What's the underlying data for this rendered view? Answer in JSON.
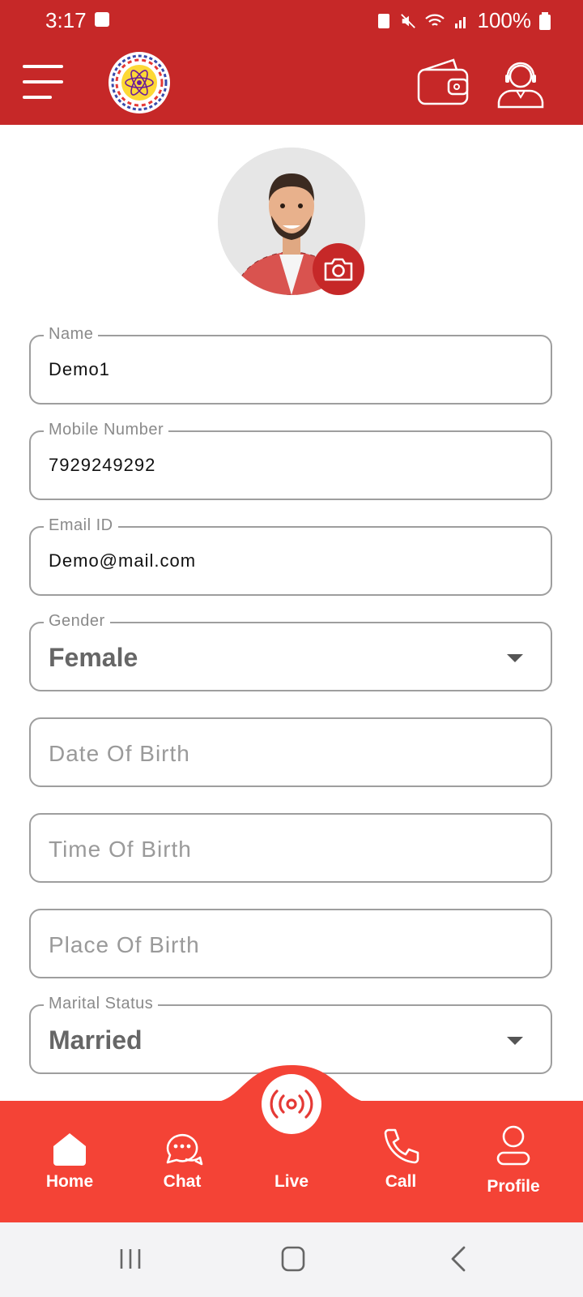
{
  "status_bar": {
    "time": "3:17",
    "battery": "100%"
  },
  "profile": {
    "avatar_alt": "profile photo"
  },
  "form": {
    "name": {
      "label": "Name",
      "value": "Demo1"
    },
    "mobile": {
      "label": "Mobile Number",
      "value": "7929249292"
    },
    "email": {
      "label": "Email ID",
      "value": "Demo@mail.com"
    },
    "gender": {
      "label": "Gender",
      "value": "Female"
    },
    "dob": {
      "placeholder": "Date Of Birth"
    },
    "tob": {
      "placeholder": "Time Of Birth"
    },
    "pob": {
      "placeholder": "Place Of Birth"
    },
    "marital": {
      "label": "Marital Status",
      "value": "Married"
    }
  },
  "bottom_nav": {
    "home": "Home",
    "chat": "Chat",
    "live": "Live",
    "call": "Call",
    "profile": "Profile"
  },
  "colors": {
    "brand_red": "#c62828",
    "nav_red": "#f44336"
  }
}
